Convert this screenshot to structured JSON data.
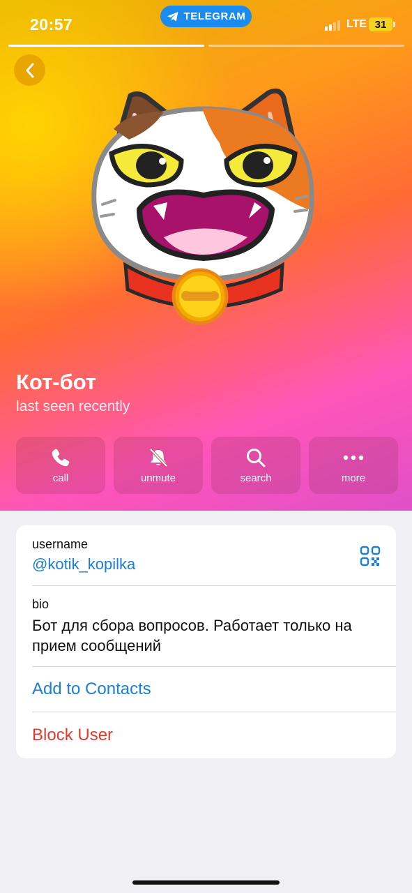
{
  "status_bar": {
    "time": "20:57",
    "app_pill": "TELEGRAM",
    "network": "LTE",
    "battery": "31"
  },
  "profile": {
    "name": "Кот-бот",
    "status": "last seen recently"
  },
  "actions": [
    {
      "label": "call",
      "icon": "phone-icon"
    },
    {
      "label": "unmute",
      "icon": "bell-slash-icon"
    },
    {
      "label": "search",
      "icon": "search-icon"
    },
    {
      "label": "more",
      "icon": "ellipsis-icon"
    }
  ],
  "info": {
    "username_label": "username",
    "username_value": "@kotik_kopilka",
    "bio_label": "bio",
    "bio_value": "Бот для сбора вопросов. Работает только на прием сообщений",
    "add_contact": "Add to Contacts",
    "block_user": "Block User"
  },
  "colors": {
    "accent": "#1a7fd6",
    "danger": "#e5392f",
    "telegram_pill": "#1a8cf0"
  }
}
